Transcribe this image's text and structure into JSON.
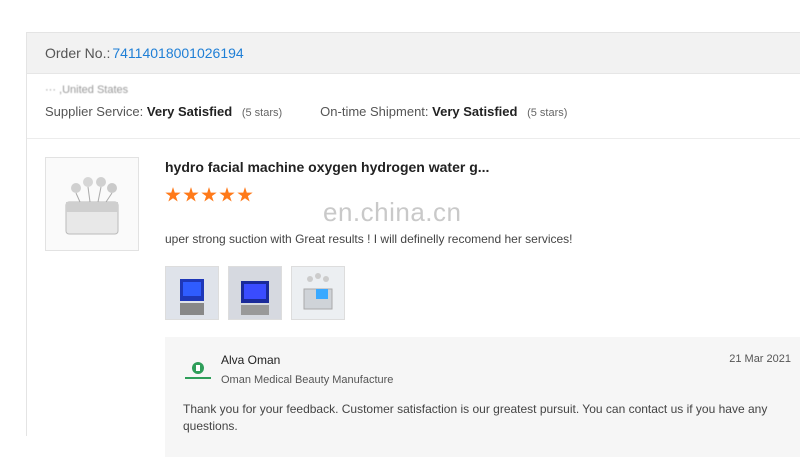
{
  "order": {
    "label": "Order No.:",
    "number": "74114018001026194"
  },
  "buyer": {
    "location": "··· ,United States"
  },
  "ratings": {
    "supplier_label": "Supplier Service:",
    "supplier_value": "Very Satisfied",
    "supplier_stars_text": "(5 stars)",
    "shipment_label": "On-time Shipment:",
    "shipment_value": "Very Satisfied",
    "shipment_stars_text": "(5 stars)"
  },
  "product": {
    "title": "hydro facial machine oxygen hydrogen water g...",
    "rating": 5,
    "review": "uper strong suction with Great results ! I will definelly recomend her services!",
    "photos": [
      "review-photo-1",
      "review-photo-2",
      "review-photo-3"
    ]
  },
  "watermark": "en.china.cn",
  "reply": {
    "author": "Alva Oman",
    "company": "Oman Medical Beauty Manufacture",
    "date": "21 Mar 2021",
    "message": "Thank you for your feedback. Customer satisfaction is our greatest pursuit. You can contact us if you have any questions."
  },
  "colors": {
    "accent": "#1f7fd6",
    "star": "#ff7a1a",
    "logo": "#2f9e5a"
  }
}
